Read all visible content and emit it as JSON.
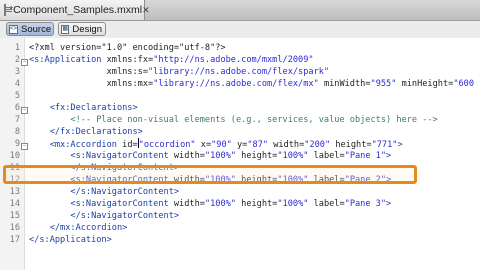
{
  "tab": {
    "title": "*Component_Samples.mxml",
    "close": "✕"
  },
  "toolbar": {
    "source_label": "Source",
    "design_label": "Design"
  },
  "lines": [
    {
      "n": "1",
      "segs": [
        [
          "pl",
          "<?xml version=\"1.0\" encoding=\"utf-8\"?>"
        ]
      ]
    },
    {
      "n": "2",
      "segs": [
        [
          "tg",
          "<s:Application "
        ],
        [
          "at",
          "xmlns:fx="
        ],
        [
          "vl",
          "\"http://ns.adobe.com/mxml/2009\""
        ]
      ]
    },
    {
      "n": "3",
      "segs": [
        [
          "at",
          "               xmlns:s="
        ],
        [
          "vl",
          "\"library://ns.adobe.com/flex/spark\""
        ]
      ]
    },
    {
      "n": "4",
      "segs": [
        [
          "at",
          "               xmlns:mx="
        ],
        [
          "vl",
          "\"library://ns.adobe.com/flex/mx\""
        ],
        [
          "at",
          " minWidth="
        ],
        [
          "vl",
          "\"955\""
        ],
        [
          "at",
          " minHeight="
        ],
        [
          "vl",
          "\"600"
        ]
      ]
    },
    {
      "n": "5",
      "segs": []
    },
    {
      "n": "6",
      "segs": [
        [
          "tg",
          "    <fx:Declarations>"
        ]
      ]
    },
    {
      "n": "7",
      "segs": [
        [
          "cm",
          "        <!-- Place non-visual elements (e.g., services, value objects) here -->"
        ]
      ]
    },
    {
      "n": "8",
      "segs": [
        [
          "tg",
          "    </fx:Declarations>"
        ]
      ]
    },
    {
      "n": "9",
      "segs": [
        [
          "tg",
          "    <mx:Accordion "
        ],
        [
          "at",
          "id="
        ],
        [
          "vl",
          "\"occordion\""
        ],
        [
          "at",
          " x="
        ],
        [
          "vl",
          "\"90\""
        ],
        [
          "at",
          " y="
        ],
        [
          "vl",
          "\"87\""
        ],
        [
          "at",
          " width="
        ],
        [
          "vl",
          "\"200\""
        ],
        [
          "at",
          " height="
        ],
        [
          "vl",
          "\"771\""
        ],
        [
          "tg",
          ">"
        ]
      ]
    },
    {
      "n": "10",
      "segs": [
        [
          "tg",
          "        <s:NavigatorContent "
        ],
        [
          "at",
          "width="
        ],
        [
          "vl",
          "\"100%\""
        ],
        [
          "at",
          " height="
        ],
        [
          "vl",
          "\"100%\""
        ],
        [
          "at",
          " label="
        ],
        [
          "vl",
          "\"Pane 1\""
        ],
        [
          "tg",
          ">"
        ]
      ]
    },
    {
      "n": "11",
      "segs": [
        [
          "tg",
          "        </s:NavigatorContent>"
        ]
      ]
    },
    {
      "n": "12",
      "segs": [
        [
          "tg",
          "        <s:NavigatorContent "
        ],
        [
          "at",
          "width="
        ],
        [
          "vl",
          "\"100%\""
        ],
        [
          "at",
          " height="
        ],
        [
          "vl",
          "\"100%\""
        ],
        [
          "at",
          " label="
        ],
        [
          "vl",
          "\"Pane 2\""
        ],
        [
          "tg",
          ">"
        ]
      ]
    },
    {
      "n": "13",
      "segs": [
        [
          "tg",
          "        </s:NavigatorContent>"
        ]
      ]
    },
    {
      "n": "14",
      "segs": [
        [
          "tg",
          "        <s:NavigatorContent "
        ],
        [
          "at",
          "width="
        ],
        [
          "vl",
          "\"100%\""
        ],
        [
          "at",
          " height="
        ],
        [
          "vl",
          "\"100%\""
        ],
        [
          "at",
          " label="
        ],
        [
          "vl",
          "\"Pane 3\""
        ],
        [
          "tg",
          ">"
        ]
      ]
    },
    {
      "n": "15",
      "segs": [
        [
          "tg",
          "        </s:NavigatorContent>"
        ]
      ]
    },
    {
      "n": "16",
      "segs": [
        [
          "tg",
          "    </mx:Accordion>"
        ]
      ]
    },
    {
      "n": "17",
      "segs": [
        [
          "tg",
          "</s:Application>"
        ]
      ]
    }
  ]
}
